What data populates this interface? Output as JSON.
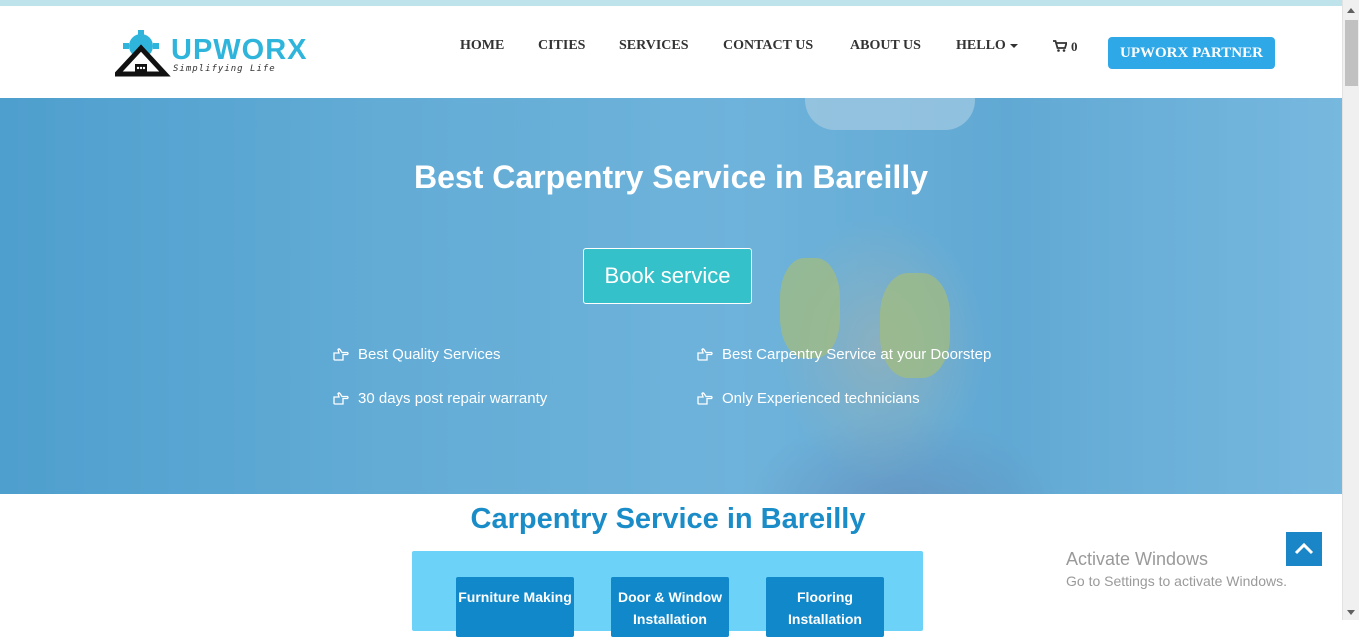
{
  "brand": {
    "name": "UPWORX",
    "tagline": "Simplifying Life"
  },
  "nav": {
    "items": [
      "HOME",
      "CITIES",
      "SERVICES",
      "CONTACT US",
      "ABOUT US",
      "HELLO"
    ],
    "cart_count": "0",
    "partner_label": "UPWORX PARTNER"
  },
  "hero": {
    "title": "Best Carpentry Service in Bareilly",
    "cta": "Book service",
    "features": [
      "Best Quality Services",
      "Best Carpentry Service at your Doorstep",
      "30 days post repair warranty",
      "Only Experienced technicians"
    ]
  },
  "section": {
    "title": "Carpentry Service in Bareilly",
    "services": [
      {
        "line1": "Furniture Making",
        "line2": ""
      },
      {
        "line1": "Door & Window",
        "line2": "Installation"
      },
      {
        "line1": "Flooring",
        "line2": "Installation"
      }
    ]
  },
  "watermark": {
    "title": "Activate Windows",
    "subtitle": "Go to Settings to activate Windows."
  },
  "colors": {
    "accent": "#2fa8e8",
    "cta": "#34c1c9",
    "heading": "#1a8cc8",
    "panel": "#6dd2f7",
    "service_tile": "#1188c9"
  },
  "icons": {
    "features": "hand-point-right-icon",
    "cart": "shopping-cart-icon",
    "back_to_top": "chevron-up-icon"
  }
}
